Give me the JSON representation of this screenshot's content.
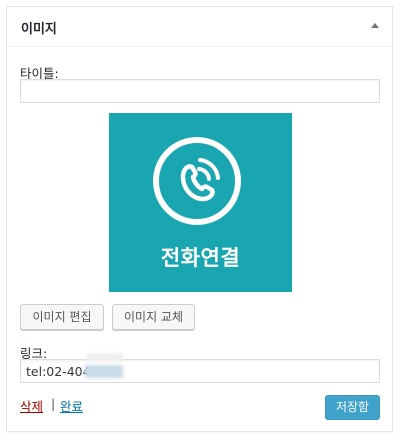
{
  "widget": {
    "title": "이미지",
    "toggle_icon": "triangle-up-icon"
  },
  "title_field": {
    "label": "타이틀:",
    "value": ""
  },
  "image": {
    "caption": "전화연결",
    "background_color": "#1aa6b1",
    "icon": "phone-icon"
  },
  "buttons": {
    "edit_label": "이미지 편집",
    "replace_label": "이미지 교체"
  },
  "link_field": {
    "label": "링크:",
    "value": "tel:02-404-"
  },
  "footer": {
    "delete_label": "삭제",
    "separator": "|",
    "done_label": "완료",
    "save_label": "저장함"
  },
  "colors": {
    "accent": "#0085ba",
    "delete": "#a00000",
    "link": "#0073aa"
  }
}
